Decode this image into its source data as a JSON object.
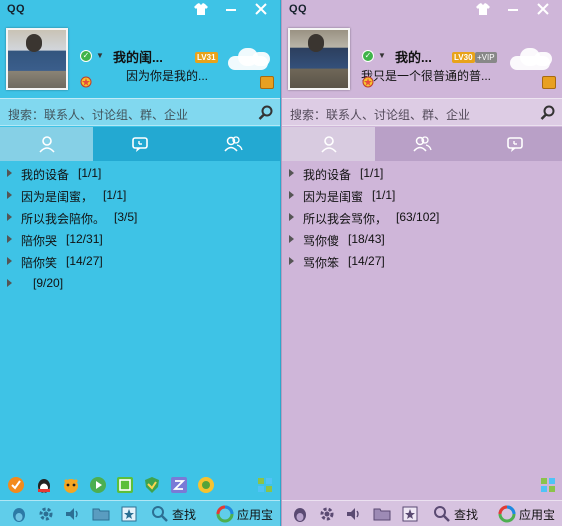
{
  "left_panel": {
    "app_title": "QQ",
    "window_controls": [
      "skin",
      "minimize",
      "close"
    ],
    "nickname": "我的闺...",
    "level_badge": "LV31",
    "signature": "因为你是我的...",
    "search_placeholder": "搜索：联系人、讨论组、群、企业",
    "tabs": [
      {
        "name": "contacts",
        "icon": "person-icon",
        "active": true
      },
      {
        "name": "messages",
        "icon": "chat-icon",
        "active": false
      },
      {
        "name": "groups",
        "icon": "group-icon",
        "active": false
      }
    ],
    "groups": [
      {
        "name": "我的设备",
        "count": "[1/1]"
      },
      {
        "name": "因为是闺蜜，",
        "count": "[1/1]"
      },
      {
        "name": "所以我会陪你。",
        "count": "[3/5]"
      },
      {
        "name": "陪你哭",
        "count": "[12/31]"
      },
      {
        "name": "陪你笑",
        "count": "[14/27]"
      },
      {
        "name": "",
        "count": "[9/20]"
      }
    ],
    "bottom_find": "查找",
    "bottom_appstore": "应用宝"
  },
  "right_panel": {
    "app_title": "QQ",
    "window_controls": [
      "skin",
      "minimize",
      "close"
    ],
    "nickname": "我的...",
    "level_badge": "LV30",
    "vip_badge": "+VIP",
    "signature": "我只是一个很普通的普...",
    "search_placeholder": "搜索：联系人、讨论组、群、企业",
    "tabs": [
      {
        "name": "contacts",
        "icon": "person-icon",
        "active": true
      },
      {
        "name": "groups",
        "icon": "group-icon",
        "active": false
      },
      {
        "name": "messages",
        "icon": "chat-icon",
        "active": false
      }
    ],
    "groups": [
      {
        "name": "我的设备",
        "count": "[1/1]"
      },
      {
        "name": "因为是闺蜜",
        "count": "[1/1]"
      },
      {
        "name": "所以我会骂你，",
        "count": "[63/102]"
      },
      {
        "name": "骂你傻",
        "count": "[18/43]"
      },
      {
        "name": "骂你笨",
        "count": "[14/27]"
      }
    ],
    "bottom_find": "查找",
    "bottom_appstore": "应用宝"
  },
  "colors": {
    "left_bg": "#3ec3e6",
    "right_bg": "#cfb6d9",
    "online_green": "#3fb34a",
    "level_gold": "#e8a31a"
  }
}
